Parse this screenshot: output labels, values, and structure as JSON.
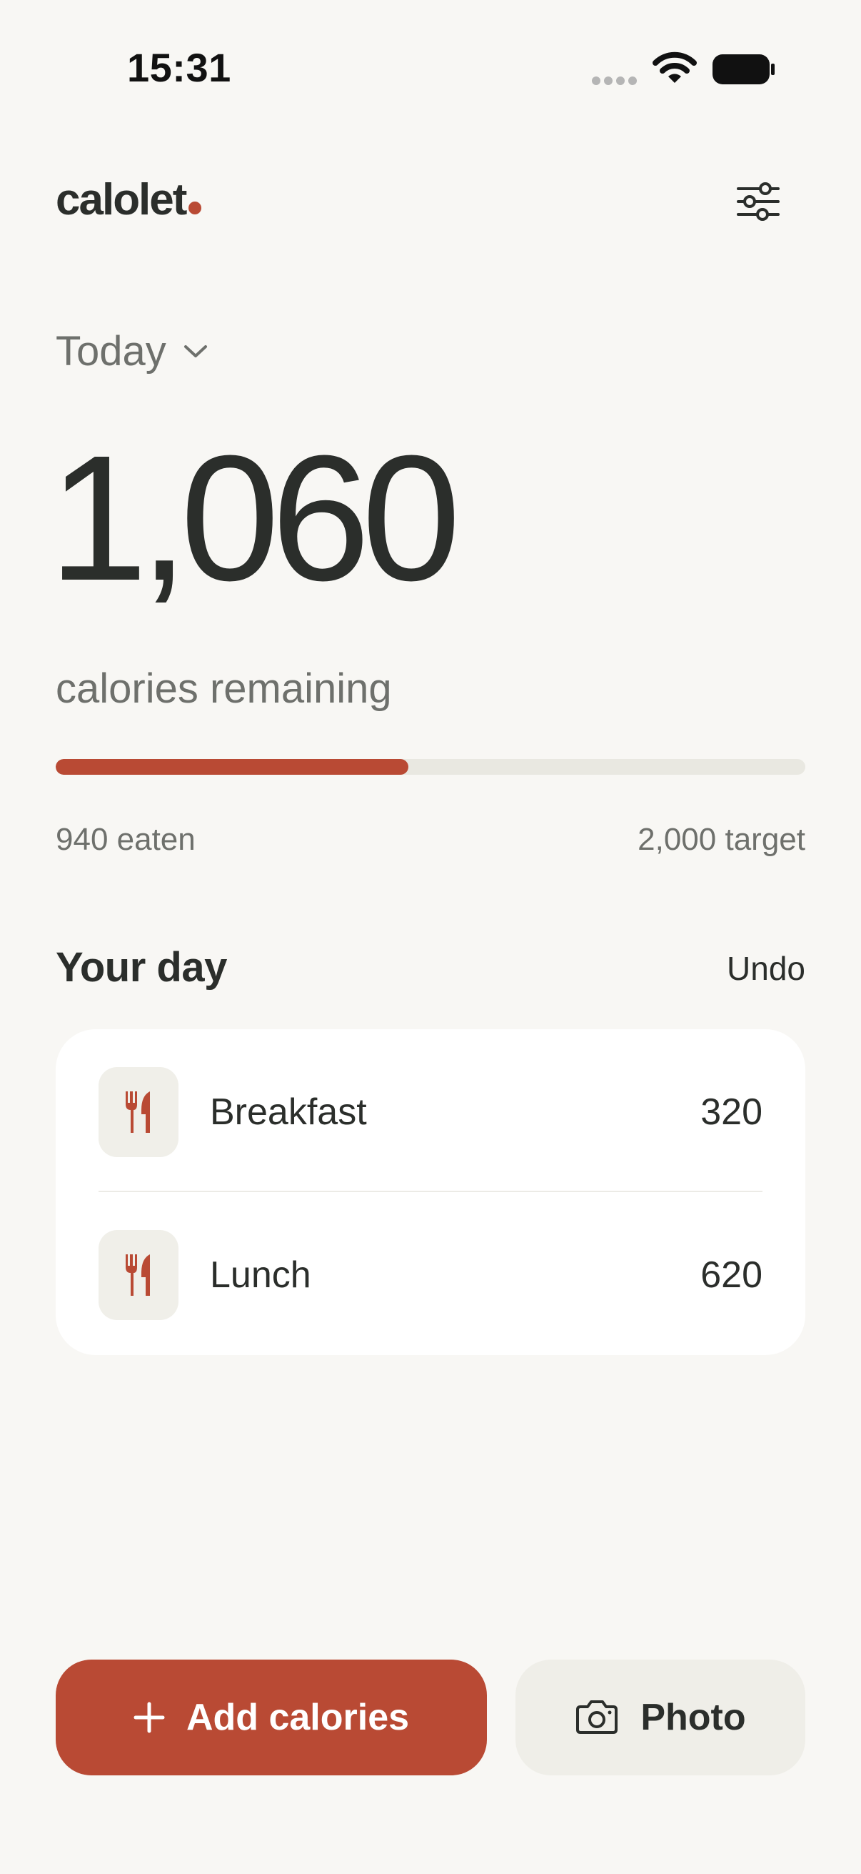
{
  "status_bar": {
    "time": "15:31",
    "signal_icon": "signal-dots-icon",
    "wifi_icon": "wifi-icon",
    "battery_icon": "battery-icon"
  },
  "header": {
    "logo_text": "calolet",
    "settings_icon": "sliders-icon"
  },
  "date_selector": {
    "label": "Today",
    "icon": "chevron-down-icon"
  },
  "summary": {
    "remaining": "1,060",
    "remaining_label": "calories remaining",
    "eaten_label": "940 eaten",
    "target_label": "2,000 target",
    "progress_fraction": 0.47
  },
  "day": {
    "title": "Your day",
    "undo_label": "Undo",
    "meals": [
      {
        "name": "Breakfast",
        "calories": "320",
        "icon": "fork-knife-icon"
      },
      {
        "name": "Lunch",
        "calories": "620",
        "icon": "fork-knife-icon"
      }
    ]
  },
  "actions": {
    "add_label": "Add calories",
    "add_icon": "plus-icon",
    "photo_label": "Photo",
    "photo_icon": "camera-icon"
  },
  "colors": {
    "accent": "#b94a34",
    "background": "#f8f7f4",
    "track": "#e9e8e1",
    "text": "#2b2e2b",
    "muted": "#6e706c"
  }
}
